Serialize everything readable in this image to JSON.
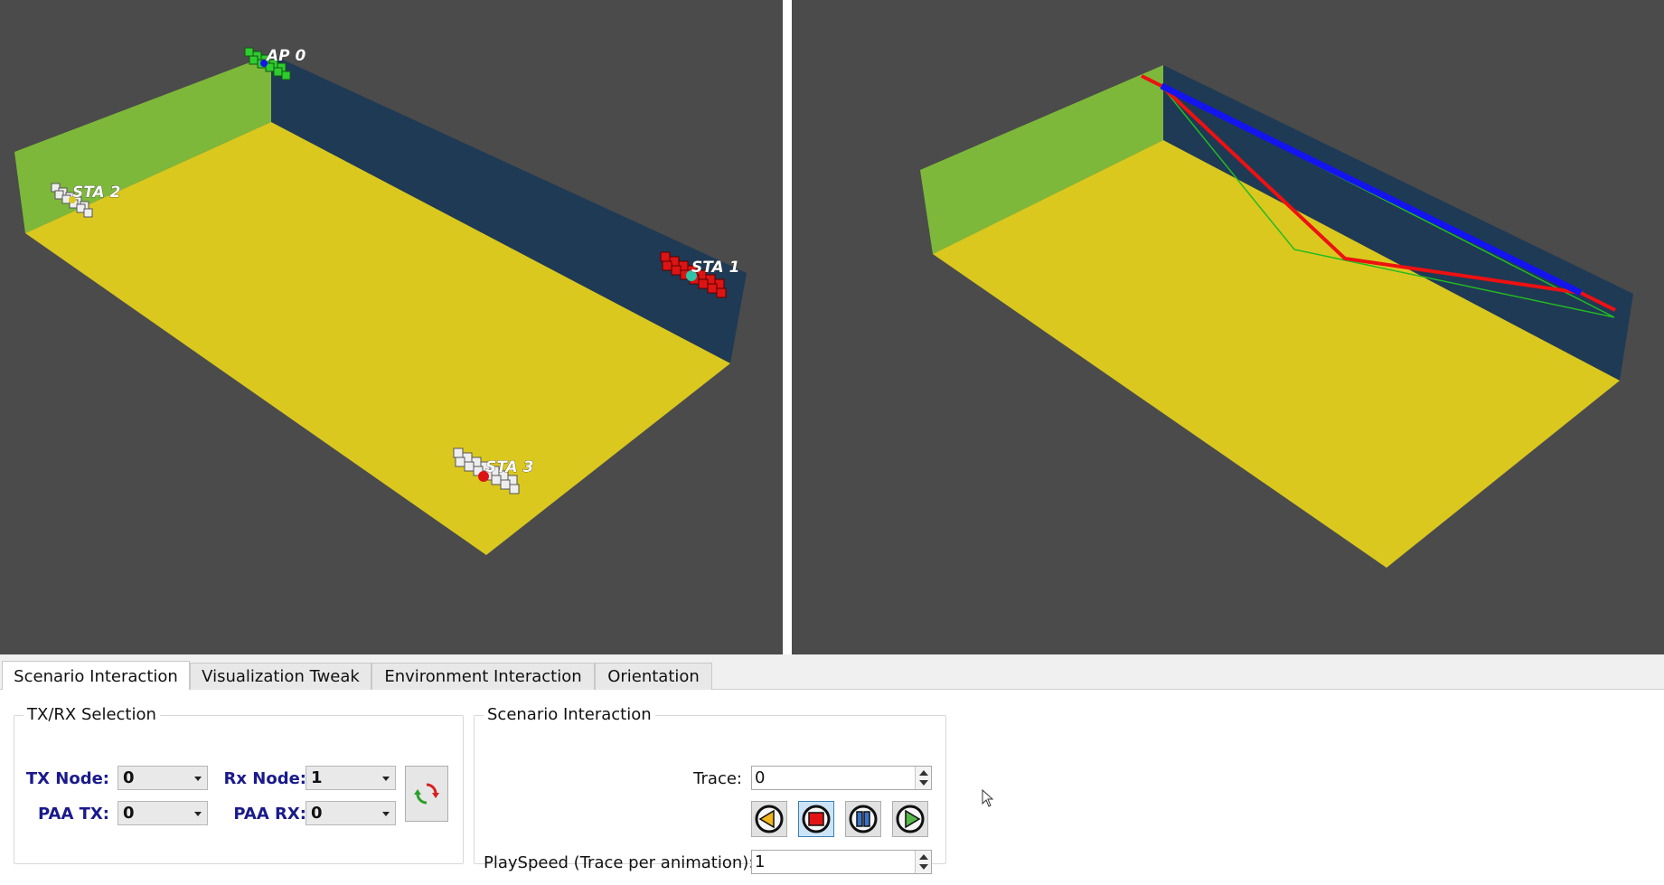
{
  "views": {
    "left": {
      "nodes": [
        {
          "label": "AP 0",
          "color": "#22bb22"
        },
        {
          "label": "STA 1",
          "color": "#cc1111"
        },
        {
          "label": "STA 2",
          "color": "#dddddd"
        },
        {
          "label": "STA 3",
          "color": "#dddddd"
        }
      ]
    },
    "colors": {
      "background": "#4b4b4b",
      "floor": "#dac81f",
      "left_wall": "#7db83a",
      "back_wall": "#1f3a55",
      "los_ray": "#1414ee",
      "reflected_ray": "#ee1111",
      "diffuse_ray": "#22bb22"
    }
  },
  "tabs": [
    {
      "label": "Scenario Interaction",
      "active": true
    },
    {
      "label": "Visualization Tweak",
      "active": false
    },
    {
      "label": "Environment Interaction",
      "active": false
    },
    {
      "label": "Orientation",
      "active": false
    }
  ],
  "txrx": {
    "title": "TX/RX Selection",
    "tx_node_label": "TX Node:",
    "tx_node_value": "0",
    "rx_node_label": "Rx Node:",
    "rx_node_value": "1",
    "paa_tx_label": "PAA TX:",
    "paa_tx_value": "0",
    "paa_rx_label": "PAA RX:",
    "paa_rx_value": "0",
    "refresh_icon": "refresh-icon"
  },
  "scenario": {
    "title": "Scenario Interaction",
    "trace_label": "Trace:",
    "trace_value": "0",
    "playspeed_label": "PlaySpeed (Trace per animation):",
    "playspeed_value": "1",
    "controls": [
      "step-back-icon",
      "stop-icon",
      "pause-icon",
      "play-icon"
    ]
  }
}
